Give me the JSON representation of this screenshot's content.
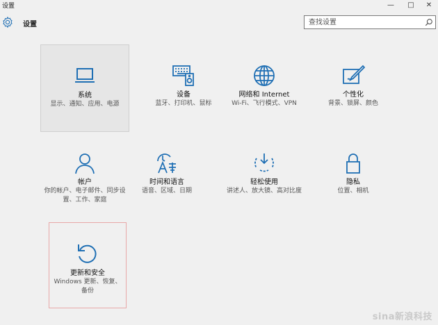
{
  "window": {
    "title": "设置",
    "controls": {
      "minimize": "—",
      "maximize": "□",
      "close": "✕"
    }
  },
  "header": {
    "icon": "gear-icon",
    "title": "设置"
  },
  "search": {
    "placeholder": "查找设置",
    "icon": "search-icon"
  },
  "tiles": [
    {
      "id": "system",
      "icon": "laptop-icon",
      "label": "系统",
      "desc": "显示、通知、应用、电源"
    },
    {
      "id": "devices",
      "icon": "keyboard-speaker-icon",
      "label": "设备",
      "desc": "蓝牙、打印机、鼠标"
    },
    {
      "id": "network",
      "icon": "globe-icon",
      "label": "网络和 Internet",
      "desc": "Wi-Fi、飞行模式、VPN"
    },
    {
      "id": "personalization",
      "icon": "paint-icon",
      "label": "个性化",
      "desc": "背景、锁屏、颜色"
    },
    {
      "id": "accounts",
      "icon": "person-icon",
      "label": "帐户",
      "desc": "你的帐户、电子邮件、同步设置、工作、家庭"
    },
    {
      "id": "time-language",
      "icon": "time-language-icon",
      "label": "时间和语言",
      "desc": "语音、区域、日期"
    },
    {
      "id": "ease-of-access",
      "icon": "ease-of-access-icon",
      "label": "轻松使用",
      "desc": "讲述人、放大镜、高对比度"
    },
    {
      "id": "privacy",
      "icon": "lock-icon",
      "label": "隐私",
      "desc": "位置、相机"
    },
    {
      "id": "update-security",
      "icon": "refresh-icon",
      "label": "更新和安全",
      "desc": "Windows 更新、恢复、备份"
    }
  ],
  "watermark": "sina新浪科技",
  "colors": {
    "accent": "#1f6fb4",
    "background": "#f0f0f0",
    "focus_border": "#e8a7a7"
  }
}
